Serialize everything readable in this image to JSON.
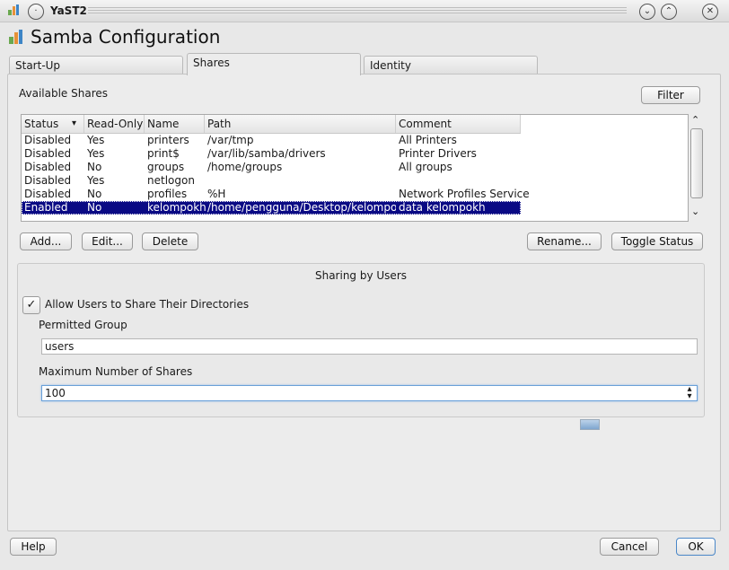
{
  "window": {
    "title": "YaST2"
  },
  "header": {
    "title": "Samba Configuration"
  },
  "tabs": [
    {
      "label": "Start-Up"
    },
    {
      "label": "Shares"
    },
    {
      "label": "Identity"
    }
  ],
  "shares": {
    "label": "Available Shares",
    "filter_label": "Filter",
    "columns": [
      "Status",
      "Read-Only",
      "Name",
      "Path",
      "Comment"
    ],
    "rows": [
      [
        "Disabled",
        "Yes",
        "printers",
        "/var/tmp",
        "All Printers"
      ],
      [
        "Disabled",
        "Yes",
        "print$",
        "/var/lib/samba/drivers",
        "Printer Drivers"
      ],
      [
        "Disabled",
        "No",
        "groups",
        "/home/groups",
        "All groups"
      ],
      [
        "Disabled",
        "Yes",
        "netlogon",
        "",
        ""
      ],
      [
        "Disabled",
        "No",
        "profiles",
        "%H",
        "Network Profiles Service"
      ],
      [
        "Enabled",
        "No",
        "kelompokh",
        "/home/pengguna/Desktop/kelompokh",
        "data kelompokh"
      ]
    ],
    "buttons": {
      "add": "Add...",
      "edit": "Edit...",
      "delete": "Delete",
      "rename": "Rename...",
      "toggle": "Toggle Status"
    }
  },
  "sharing": {
    "title": "Sharing by Users",
    "allow_label": "Allow Users to Share Their Directories",
    "allow_checked": true,
    "group_label": "Permitted Group",
    "group_value": "users",
    "max_label": "Maximum Number of Shares",
    "max_value": "100"
  },
  "footer": {
    "help": "Help",
    "cancel": "Cancel",
    "ok": "OK"
  }
}
